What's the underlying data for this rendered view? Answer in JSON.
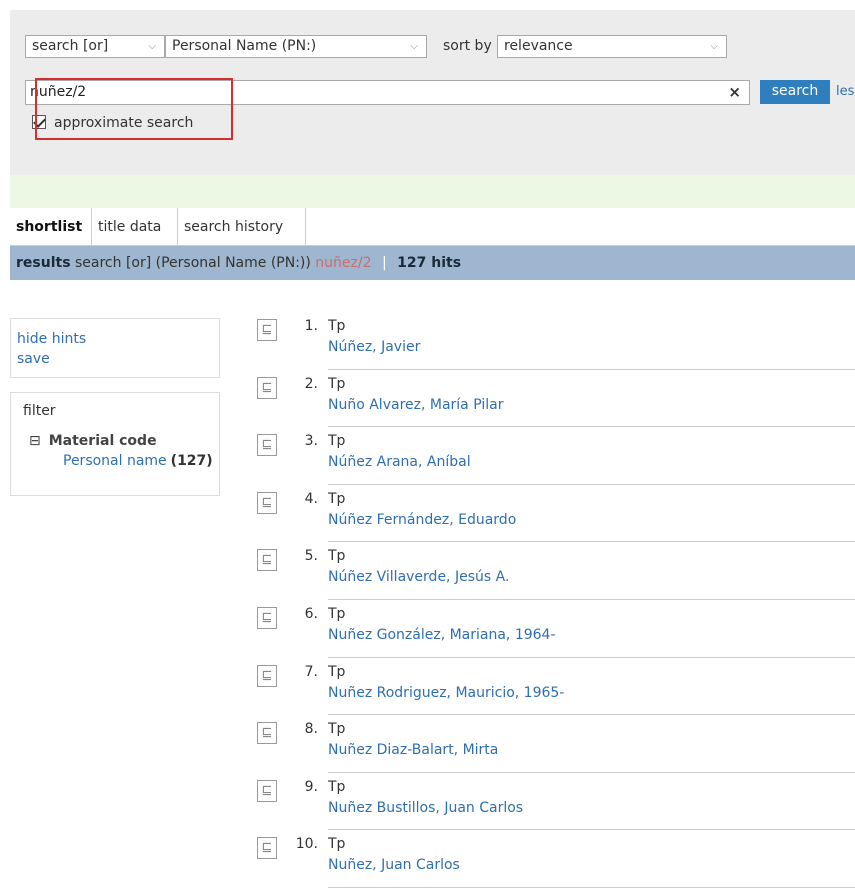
{
  "search": {
    "mode": "search [or]",
    "field": "Personal Name (PN:)",
    "sort_label": "sort by",
    "sort_value": "relevance",
    "query": "nuñez/2",
    "clear": "×",
    "button_label": "search",
    "less_link": "less",
    "approximate_label": "approximate search"
  },
  "tabs": [
    "shortlist",
    "title data",
    "search history"
  ],
  "results_bar": {
    "label": "results",
    "mode": "search [or]",
    "field": "(Personal Name (PN:))",
    "term": "nuñez/2",
    "sep": "|",
    "hits": "127 hits"
  },
  "sidebar": {
    "hide_hints": "hide hints",
    "save": "save",
    "filter_title": "filter",
    "group_toggle": "⊟",
    "group_label": "Material code",
    "item_label": "Personal name",
    "item_count": "(127)"
  },
  "results": [
    {
      "num": "1.",
      "type": "Tp",
      "name": "Núñez, Javier"
    },
    {
      "num": "2.",
      "type": "Tp",
      "name": "Nuño Alvarez, María Pilar"
    },
    {
      "num": "3.",
      "type": "Tp",
      "name": "Núñez Arana, Aníbal"
    },
    {
      "num": "4.",
      "type": "Tp",
      "name": "Núñez Fernández, Eduardo"
    },
    {
      "num": "5.",
      "type": "Tp",
      "name": "Núñez Villaverde, Jesús A."
    },
    {
      "num": "6.",
      "type": "Tp",
      "name": "Nuñez González, Mariana, 1964-"
    },
    {
      "num": "7.",
      "type": "Tp",
      "name": "Nuñez Rodriguez, Mauricio, 1965-"
    },
    {
      "num": "8.",
      "type": "Tp",
      "name": "Nuñez Diaz-Balart, Mirta"
    },
    {
      "num": "9.",
      "type": "Tp",
      "name": "Nuñez Bustillos, Juan Carlos"
    },
    {
      "num": "10.",
      "type": "Tp",
      "name": "Nuñez, Juan Carlos"
    }
  ],
  "icons": {
    "doc": "document-icon",
    "chevron": "chevron-down-icon",
    "clear": "clear-icon",
    "checkbox": "checkbox-checked"
  },
  "colors": {
    "search_button": "#2f7fbf",
    "results_bar": "#9fb6d0",
    "highlight_box": "#d32f2f",
    "link": "#2f6fb0",
    "green_band": "#ecf8e4"
  }
}
